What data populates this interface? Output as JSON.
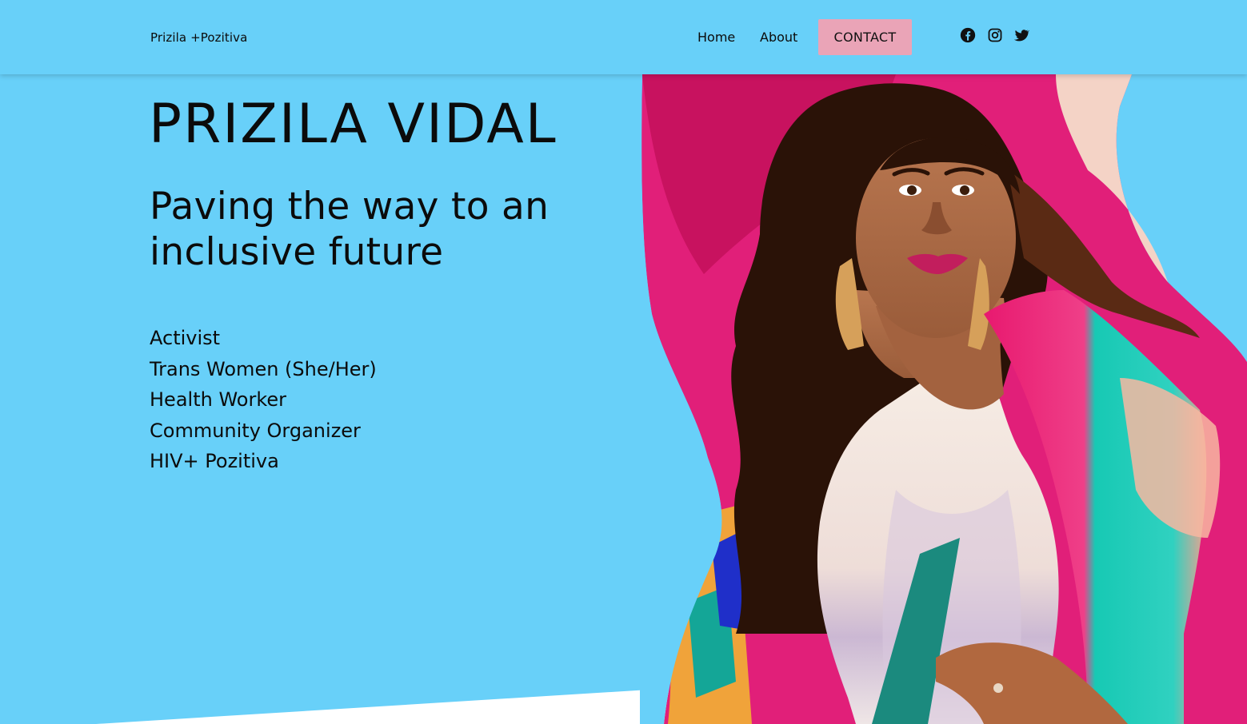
{
  "header": {
    "brand": "Prizila +Pozitiva",
    "nav": {
      "home": "Home",
      "about": "About",
      "contact": "CONTACT"
    },
    "social": [
      "facebook-icon",
      "instagram-icon",
      "twitter-icon"
    ]
  },
  "hero": {
    "title": "PRIZILA VIDAL",
    "subtitle": "Paving the way to an inclusive future",
    "roles": [
      "Activist",
      "Trans Women (She/Her)",
      "Health Worker",
      "Community Organizer",
      "HIV+ Pozitiva"
    ]
  },
  "colors": {
    "background": "#68d0f9",
    "contact_button": "#eaa4b7",
    "text": "#0b0b0b",
    "accent_pink": "#e8196f",
    "accent_teal": "#17c9b4"
  }
}
